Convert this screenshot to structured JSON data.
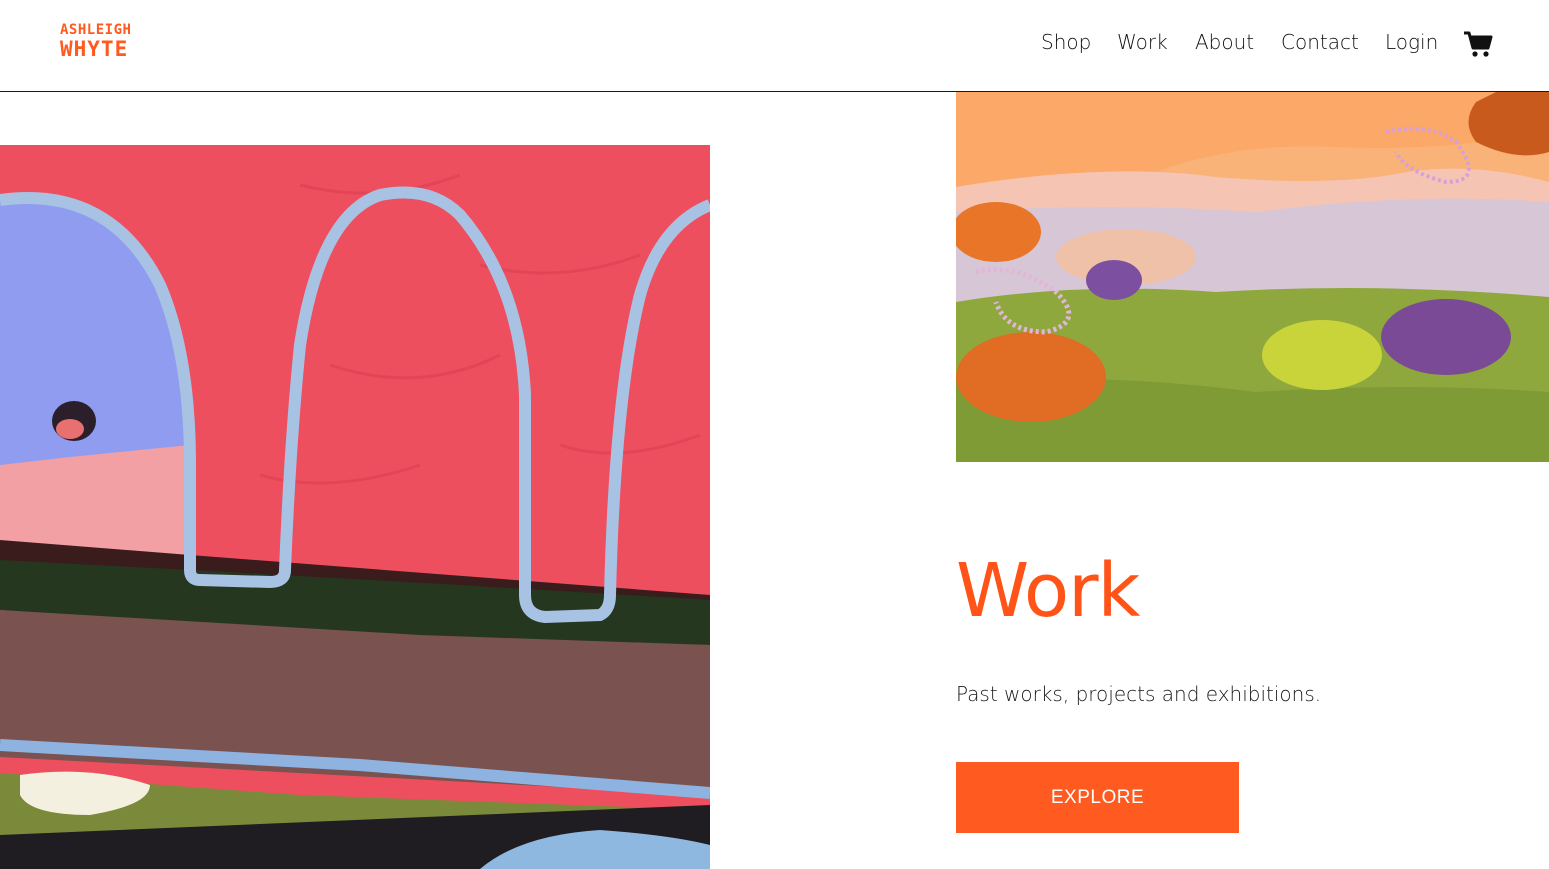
{
  "header": {
    "logo": {
      "line1": "ASHLEIGH",
      "line2": "WHYTE"
    },
    "nav": [
      {
        "label": "Shop"
      },
      {
        "label": "Work"
      },
      {
        "label": "About"
      },
      {
        "label": "Contact"
      },
      {
        "label": "Login"
      }
    ],
    "cart_icon": "shopping-cart-icon"
  },
  "main": {
    "title": "Work",
    "description": "Past works, projects and exhibitions.",
    "button_label": "EXPLORE"
  },
  "colors": {
    "accent": "#ff5a1f",
    "text": "#111111",
    "background": "#ffffff"
  }
}
